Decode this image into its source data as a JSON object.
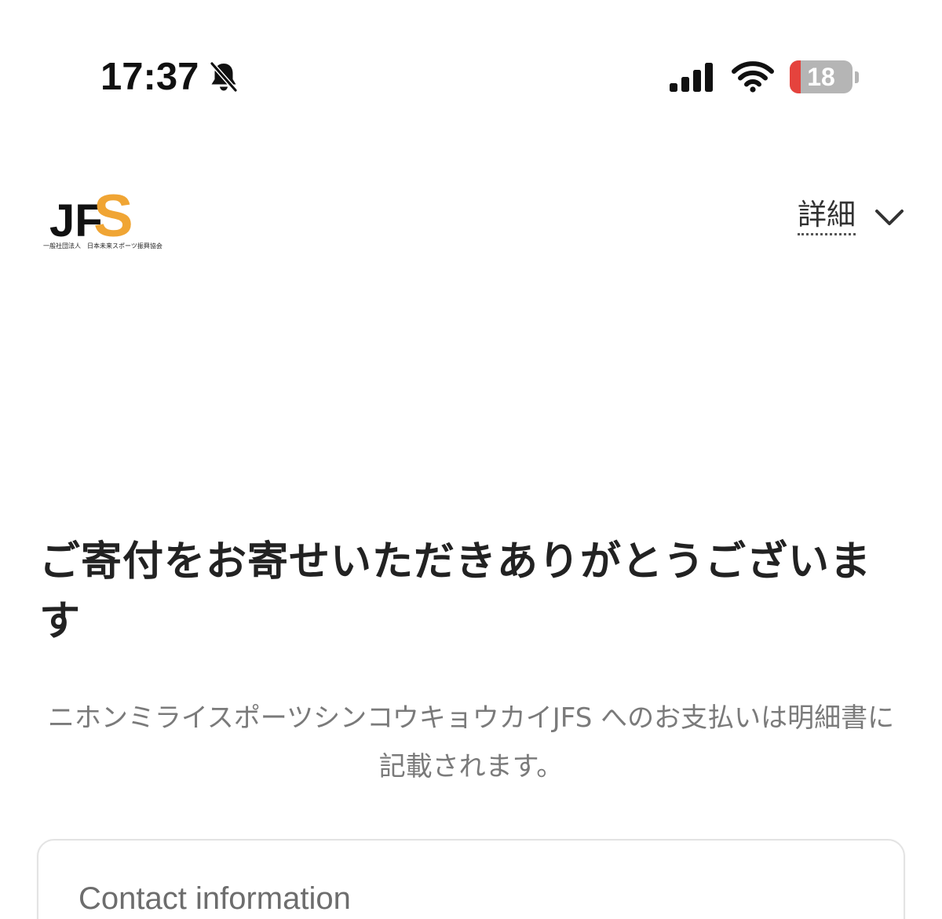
{
  "status_bar": {
    "time": "17:37",
    "battery_level": "18",
    "battery_fraction": 0.18,
    "icons": [
      "bell-slash-icon",
      "cellular-signal-icon",
      "wifi-icon",
      "battery-icon"
    ],
    "colors": {
      "battery_low": "#e5433d",
      "battery_body": "#b5b5b5"
    }
  },
  "header": {
    "logo": {
      "letters": "JFS",
      "caption": "一般社団法人　日本未来スポーツ振興協会",
      "colors": {
        "black": "#111111",
        "orange": "#f0a534"
      }
    },
    "details_label": "詳細",
    "details_icon": "chevron-down-icon"
  },
  "main": {
    "title": "ご寄付をお寄せいただきありがとうございます",
    "statement_note": "ニホンミライスポーツシンコウキョウカイJFS へのお支払いは明細書に記載されます。",
    "contact_heading": "Contact information"
  }
}
